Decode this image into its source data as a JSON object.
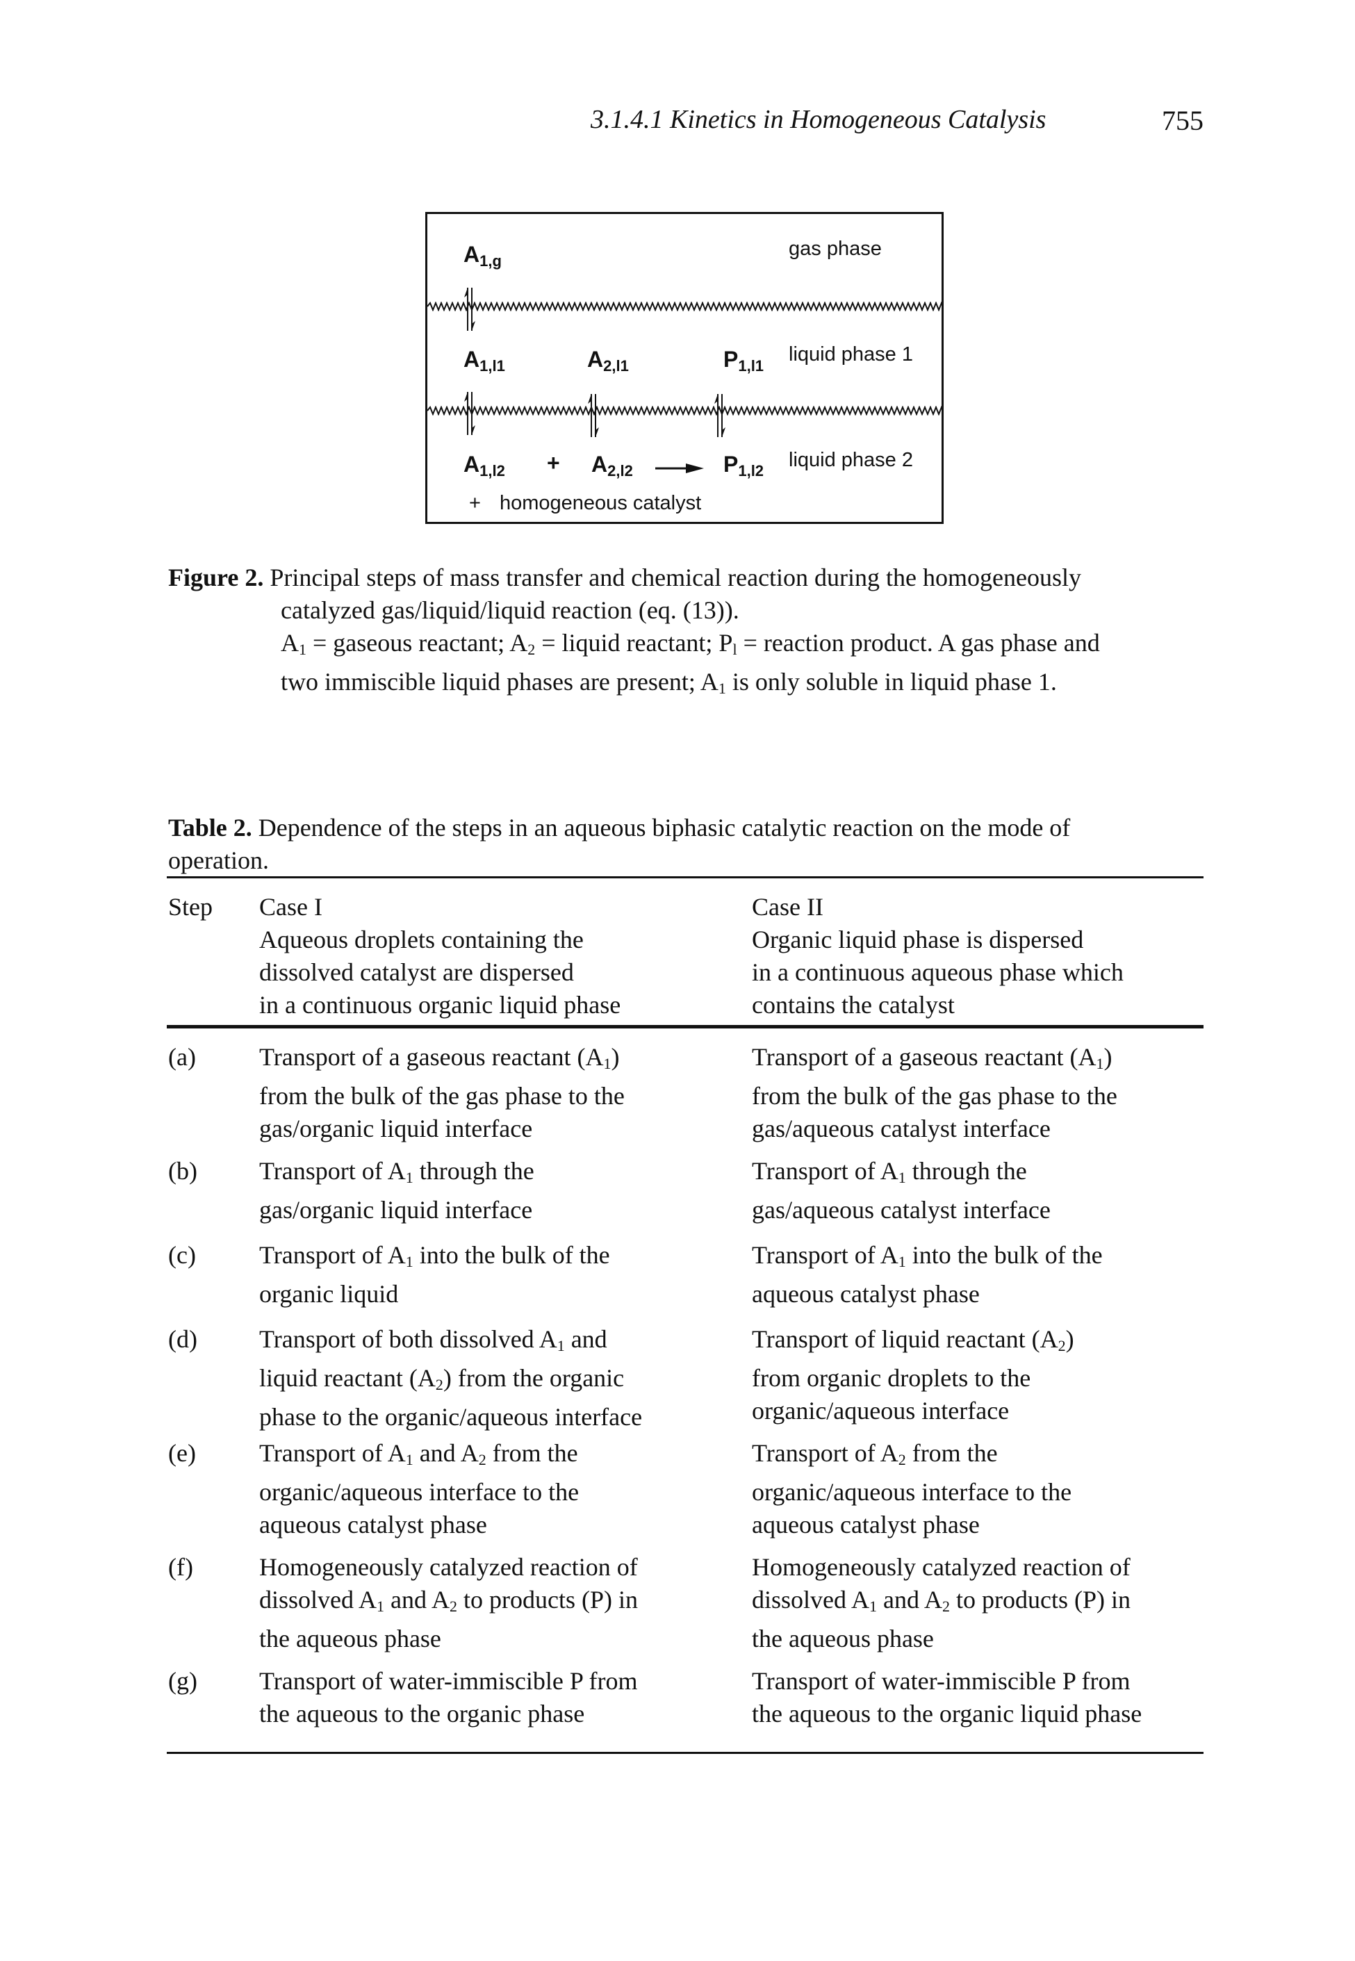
{
  "header": {
    "section": "3.1.4.1 Kinetics in Homogeneous Catalysis",
    "page_number": "755"
  },
  "diagram": {
    "gas_phase": {
      "species": [
        {
          "base": "A",
          "sub": "1,g"
        }
      ],
      "label": "gas phase"
    },
    "liquid_phase_1": {
      "species": [
        {
          "base": "A",
          "sub": "1,l1"
        },
        {
          "base": "A",
          "sub": "2,l1"
        },
        {
          "base": "P",
          "sub": "1,l1"
        }
      ],
      "label": "liquid phase 1"
    },
    "liquid_phase_2": {
      "species": [
        {
          "base": "A",
          "sub": "1,l2"
        },
        {
          "base": "A",
          "sub": "2,l2"
        },
        {
          "base": "P",
          "sub": "1,l2"
        }
      ],
      "plus": "+",
      "label": "liquid phase 2",
      "catalyst_plus": "+",
      "catalyst": "homogeneous catalyst"
    }
  },
  "figure_caption": {
    "label": "Figure 2.",
    "line1": "Principal steps of mass transfer and chemical reaction during the homogeneously",
    "line2": "catalyzed gas/liquid/liquid reaction (eq. (13)).",
    "line3": {
      "a1": "A",
      "a1_sub": "1",
      "t1": " = gaseous reactant; ",
      "a2": "A",
      "a2_sub": "2",
      "t2": " = liquid reactant; ",
      "p1": "P",
      "p1_sub": "l",
      "t3": " = reaction product. A gas phase and"
    },
    "line4": {
      "t1": "two immiscible liquid phases are present; ",
      "a1": "A",
      "a1_sub": "1",
      "t2": " is only soluble in liquid phase 1."
    }
  },
  "table": {
    "caption_label": "Table 2.",
    "caption_text": "Dependence of the steps in an aqueous biphasic catalytic reaction on the mode of",
    "caption_text2": "operation.",
    "headers": {
      "step": "Step",
      "case1": [
        "Case I",
        "Aqueous droplets containing the",
        "dissolved catalyst are dispersed",
        "in a continuous organic liquid phase"
      ],
      "case2": [
        "Case II",
        "Organic liquid phase is dispersed",
        "in a continuous aqueous phase which",
        "contains the catalyst"
      ]
    },
    "rows": [
      {
        "step": "(a)",
        "case1": [
          "Transport of a gaseous reactant (A|1|)",
          "from the bulk of the gas phase to the",
          "gas/organic liquid interface"
        ],
        "case2": [
          "Transport of a gaseous reactant (A|1|)",
          "from the bulk of the gas phase to the",
          "gas/aqueous catalyst interface"
        ]
      },
      {
        "step": "(b)",
        "case1": [
          "Transport of A|1| through the",
          "gas/organic liquid interface"
        ],
        "case2": [
          "Transport of A|1| through the",
          "gas/aqueous catalyst interface"
        ]
      },
      {
        "step": "(c)",
        "case1": [
          "Transport of A|1| into the bulk of the",
          "organic liquid"
        ],
        "case2": [
          "Transport of A|1| into the bulk of the",
          "aqueous catalyst phase"
        ]
      },
      {
        "step": "(d)",
        "case1": [
          "Transport of both dissolved A|1| and",
          "liquid reactant (A|2|) from the organic",
          "phase to the organic/aqueous interface"
        ],
        "case2": [
          "Transport of liquid reactant (A|2|)",
          "from organic droplets to the",
          "organic/aqueous interface"
        ]
      },
      {
        "step": "(e)",
        "case1": [
          "Transport of A|1| and A|2| from the",
          "organic/aqueous interface to the",
          "aqueous catalyst phase"
        ],
        "case2": [
          "Transport of A|2| from the",
          "organic/aqueous interface to the",
          "aqueous catalyst phase"
        ]
      },
      {
        "step": "(f)",
        "case1": [
          "Homogeneously catalyzed reaction of",
          "dissolved A|1| and A|2| to products (P) in",
          "the aqueous phase"
        ],
        "case2": [
          "Homogeneously catalyzed reaction of",
          "dissolved A|1| and A|2| to products (P) in",
          "the aqueous phase"
        ]
      },
      {
        "step": "(g)",
        "case1": [
          "Transport of water-immiscible P from",
          "the aqueous to the organic phase"
        ],
        "case2": [
          "Transport of water-immiscible P from",
          "the aqueous to the organic liquid phase"
        ]
      }
    ]
  }
}
